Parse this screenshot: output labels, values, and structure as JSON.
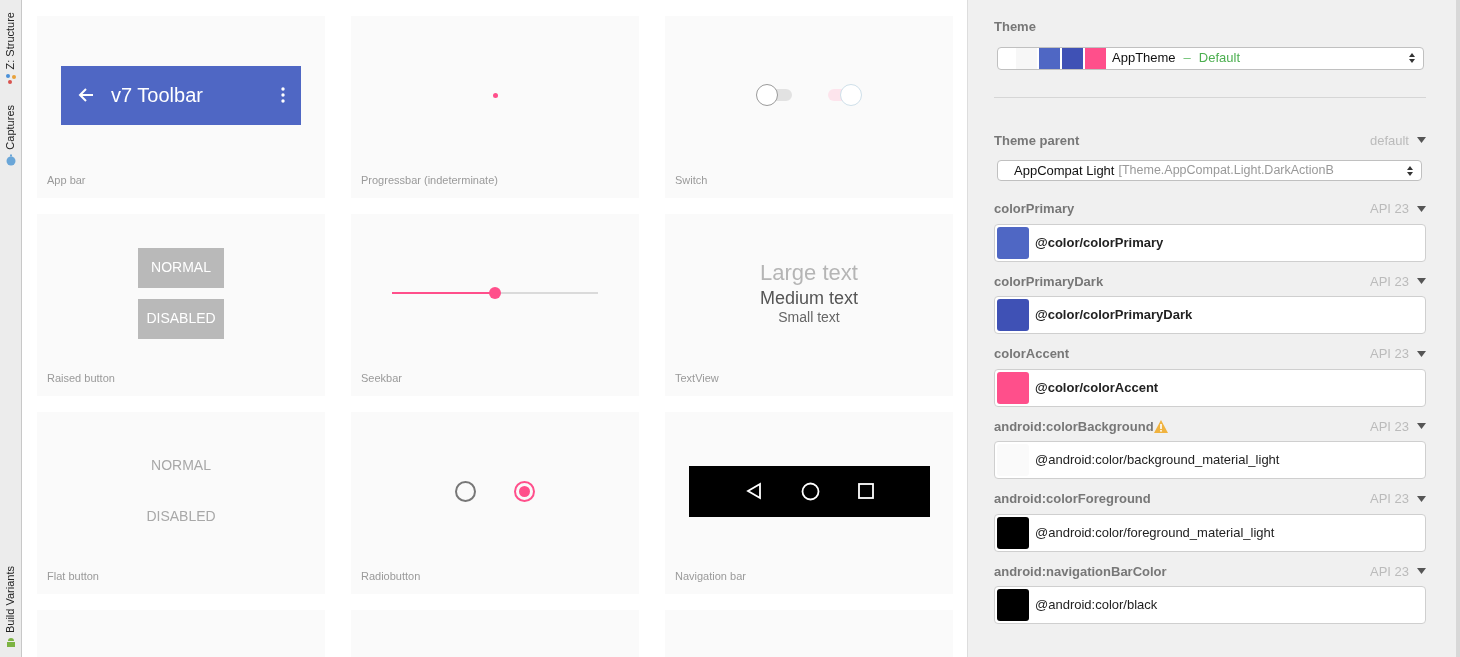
{
  "tool_strip": {
    "top": [
      {
        "label": "Z: Structure"
      },
      {
        "label": "Captures"
      }
    ],
    "bottom": [
      {
        "label": "Build Variants"
      }
    ]
  },
  "preview": {
    "cards": [
      {
        "kind": "appbar",
        "title": "v7 Toolbar",
        "caption": "App bar"
      },
      {
        "kind": "progress",
        "caption": "Progressbar (indeterminate)"
      },
      {
        "kind": "switch",
        "caption": "Switch",
        "switches": [
          {
            "on": false
          },
          {
            "on": true
          }
        ]
      },
      {
        "kind": "raised",
        "caption": "Raised button",
        "buttons": [
          {
            "label": "NORMAL"
          },
          {
            "label": "DISABLED"
          }
        ]
      },
      {
        "kind": "seekbar",
        "caption": "Seekbar",
        "level": 0.5
      },
      {
        "kind": "textview",
        "caption": "TextView",
        "texts": [
          "Large text",
          "Medium text",
          "Small text"
        ]
      },
      {
        "kind": "flat",
        "caption": "Flat button",
        "buttons": [
          {
            "label": "NORMAL"
          },
          {
            "label": "DISABLED"
          }
        ]
      },
      {
        "kind": "radio",
        "caption": "Radiobutton",
        "options": [
          {
            "selected": false
          },
          {
            "selected": true
          }
        ]
      },
      {
        "kind": "navbar",
        "caption": "Navigation bar"
      },
      {
        "kind": "blank"
      },
      {
        "kind": "blank"
      },
      {
        "kind": "blank"
      }
    ]
  },
  "theme": {
    "label": "Theme",
    "name": "AppTheme",
    "separator": "–",
    "variant": "Default",
    "swatches": [
      {
        "color": "#f7f7f7"
      },
      {
        "color": "#4f67c4"
      },
      {
        "color": "#3f51b5"
      },
      {
        "color": "#ff4f8b"
      }
    ]
  },
  "theme_parent": {
    "label": "Theme parent",
    "tag": "default",
    "name": "AppCompat Light",
    "detail": "[Theme.AppCompat.Light.DarkActionB"
  },
  "attributes": [
    {
      "name": "colorPrimary",
      "api": "API 23",
      "value": "@color/colorPrimary",
      "color": "#4f67c4",
      "warning": false,
      "bold": true
    },
    {
      "name": "colorPrimaryDark",
      "api": "API 23",
      "value": "@color/colorPrimaryDark",
      "color": "#3f51b5",
      "warning": false,
      "bold": true
    },
    {
      "name": "colorAccent",
      "api": "API 23",
      "value": "@color/colorAccent",
      "color": "#ff4f8b",
      "warning": false,
      "bold": true
    },
    {
      "name": "android:colorBackground",
      "api": "API 23",
      "value": "@android:color/background_material_light",
      "color": "#fafafa",
      "warning": true,
      "bold": false
    },
    {
      "name": "android:colorForeground",
      "api": "API 23",
      "value": "@android:color/foreground_material_light",
      "color": "#000000",
      "warning": false,
      "bold": false
    },
    {
      "name": "android:navigationBarColor",
      "api": "API 23",
      "value": "@android:color/black",
      "color": "#000000",
      "warning": false,
      "bold": false
    }
  ]
}
